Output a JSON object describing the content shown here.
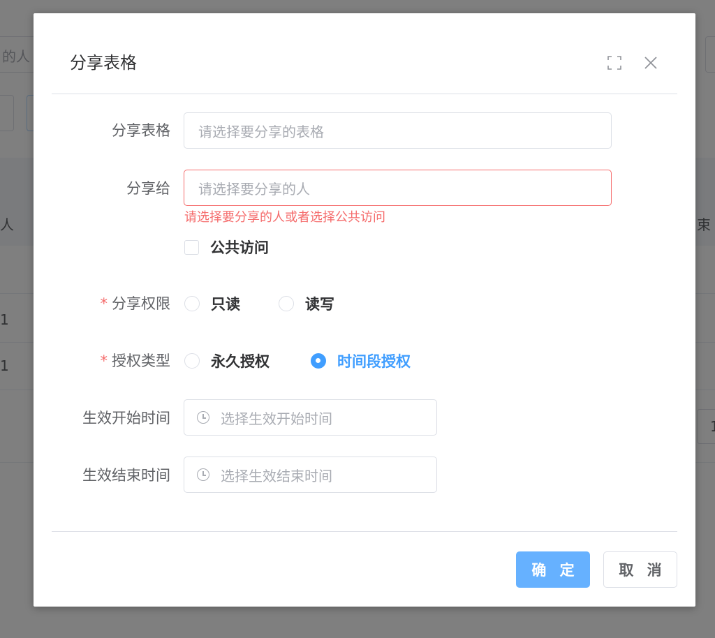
{
  "background": {
    "fragments": {
      "search_text": "的人",
      "col_header": "人",
      "col_header_right": "束",
      "row1": "1",
      "row2": "1",
      "page_box": "1"
    }
  },
  "dialog": {
    "title": "分享表格",
    "form": {
      "sheet": {
        "label": "分享表格",
        "placeholder": "请选择要分享的表格"
      },
      "share_to": {
        "label": "分享给",
        "placeholder": "请选择要分享的人",
        "error": "请选择要分享的人或者选择公共访问"
      },
      "public_access": {
        "label": "公共访问",
        "checked": false
      },
      "permission": {
        "label": "分享权限",
        "required_mark": "*",
        "options": [
          {
            "label": "只读",
            "checked": false
          },
          {
            "label": "读写",
            "checked": false
          }
        ]
      },
      "auth_type": {
        "label": "授权类型",
        "required_mark": "*",
        "options": [
          {
            "label": "永久授权",
            "checked": false
          },
          {
            "label": "时间段授权",
            "checked": true
          }
        ]
      },
      "start_time": {
        "label": "生效开始时间",
        "placeholder": "选择生效开始时间"
      },
      "end_time": {
        "label": "生效结束时间",
        "placeholder": "选择生效结束时间"
      }
    },
    "footer": {
      "confirm": "确 定",
      "cancel": "取 消"
    }
  },
  "colors": {
    "primary": "#409eff",
    "primary_light": "#66b1ff",
    "danger": "#f56c6c",
    "mask": "rgba(0,0,0,0.5)"
  },
  "icons": {
    "fullscreen": "fullscreen-icon",
    "close": "close-icon",
    "clock": "clock-icon"
  }
}
